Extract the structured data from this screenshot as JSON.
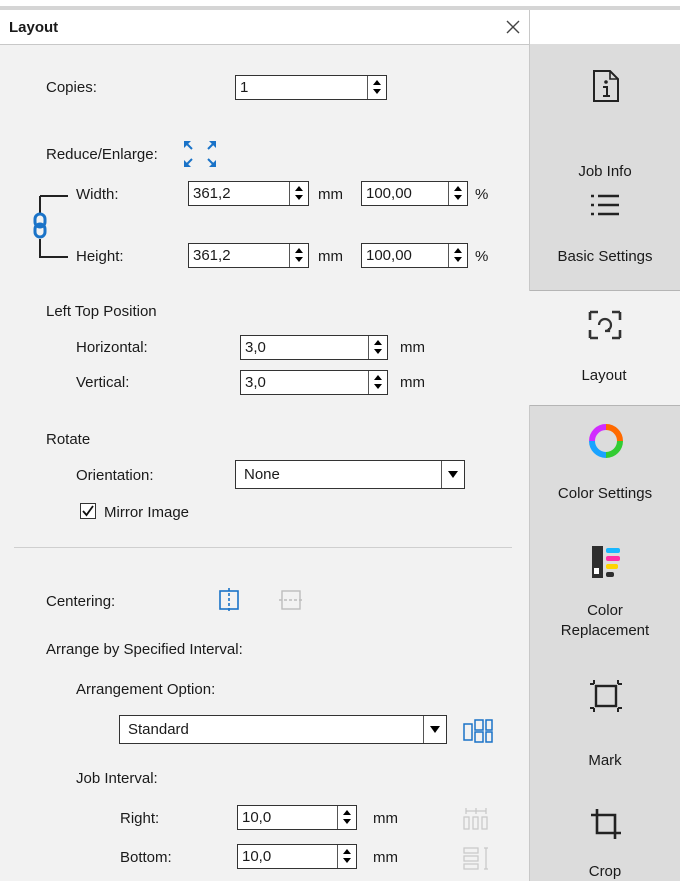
{
  "panel": {
    "title": "Layout",
    "close_label": "×"
  },
  "copies": {
    "label": "Copies:",
    "value": "1"
  },
  "reduce": {
    "label": "Reduce/Enlarge:",
    "width_label": "Width:",
    "width_value": "361,2",
    "width_unit": "mm",
    "width_percent": "100,00",
    "width_percent_unit": "%",
    "height_label": "Height:",
    "height_value": "361,2",
    "height_unit": "mm",
    "height_percent": "100,00",
    "height_percent_unit": "%"
  },
  "position": {
    "label": "Left Top Position",
    "horizontal_label": "Horizontal:",
    "horizontal_value": "3,0",
    "horizontal_unit": "mm",
    "vertical_label": "Vertical:",
    "vertical_value": "3,0",
    "vertical_unit": "mm"
  },
  "rotate": {
    "label": "Rotate",
    "orientation_label": "Orientation:",
    "orientation_value": "None",
    "mirror_label": "Mirror Image",
    "mirror_checked": true
  },
  "centering": {
    "label": "Centering:"
  },
  "arrange": {
    "label": "Arrange by Specified Interval:",
    "option_label": "Arrangement Option:",
    "option_value": "Standard",
    "interval_label": "Job Interval:",
    "right_label": "Right:",
    "right_value": "10,0",
    "right_unit": "mm",
    "bottom_label": "Bottom:",
    "bottom_value": "10,0",
    "bottom_unit": "mm"
  },
  "sidebar": {
    "tabs": [
      {
        "label": "Job Info",
        "icon": "info-icon",
        "active": false
      },
      {
        "label": "Basic Settings",
        "icon": "list-icon",
        "active": false
      },
      {
        "label": "Layout",
        "icon": "layout-icon",
        "active": true
      },
      {
        "label": "Color Settings",
        "icon": "color-wheel-icon",
        "active": false
      },
      {
        "label_line1": "Color",
        "label_line2": "Replacement",
        "icon": "color-replacement-icon",
        "active": false
      },
      {
        "label": "Mark",
        "icon": "mark-icon",
        "active": false
      },
      {
        "label": "Crop",
        "icon": "crop-icon",
        "active": false
      }
    ]
  },
  "colors": {
    "accent_blue": "#1a73c8",
    "panel_bg": "#f2f2f2",
    "tab_bg": "#dcdcdc"
  }
}
